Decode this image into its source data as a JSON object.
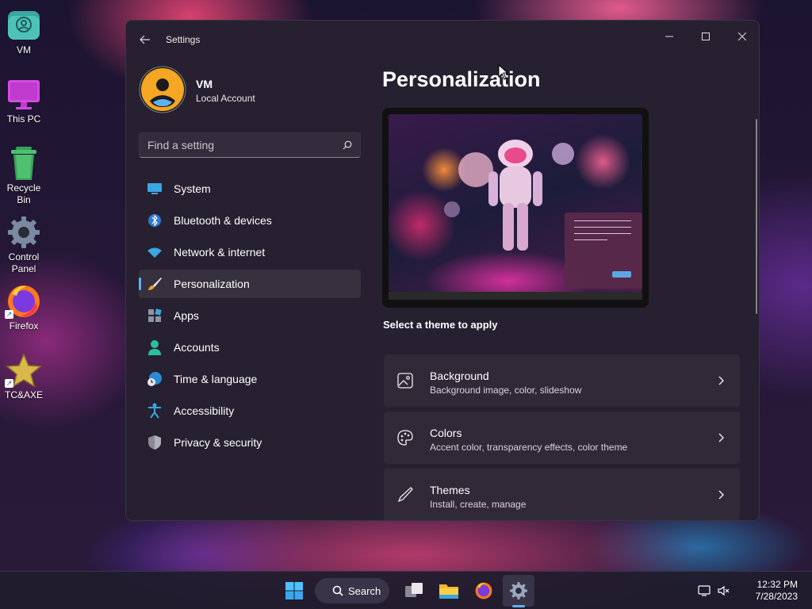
{
  "desktop": {
    "icons": [
      {
        "label": "VM"
      },
      {
        "label": "This PC"
      },
      {
        "label": "Recycle Bin"
      },
      {
        "label": "Control Panel"
      },
      {
        "label": "Firefox"
      },
      {
        "label": "TC&AXE"
      }
    ]
  },
  "window": {
    "title": "Settings",
    "profile": {
      "name": "VM",
      "account_type": "Local Account"
    },
    "search": {
      "placeholder": "Find a setting",
      "value": ""
    },
    "nav": [
      {
        "label": "System",
        "icon": "monitor-icon"
      },
      {
        "label": "Bluetooth & devices",
        "icon": "bluetooth-icon"
      },
      {
        "label": "Network & internet",
        "icon": "wifi-icon"
      },
      {
        "label": "Personalization",
        "icon": "brush-icon",
        "active": true
      },
      {
        "label": "Apps",
        "icon": "apps-icon"
      },
      {
        "label": "Accounts",
        "icon": "person-icon"
      },
      {
        "label": "Time & language",
        "icon": "globe-clock-icon"
      },
      {
        "label": "Accessibility",
        "icon": "accessibility-icon"
      },
      {
        "label": "Privacy & security",
        "icon": "shield-icon"
      }
    ],
    "page_title": "Personalization",
    "theme_prompt": "Select a theme to apply",
    "cards": [
      {
        "title": "Background",
        "subtitle": "Background image, color, slideshow",
        "icon": "image-icon"
      },
      {
        "title": "Colors",
        "subtitle": "Accent color, transparency effects, color theme",
        "icon": "palette-icon"
      },
      {
        "title": "Themes",
        "subtitle": "Install, create, manage",
        "icon": "pen-icon"
      }
    ]
  },
  "taskbar": {
    "search_label": "Search",
    "clock": {
      "time": "12:32 PM",
      "date": "7/28/2023"
    }
  },
  "colors": {
    "accent": "#5fb2f2",
    "window_bg": "#272030"
  }
}
